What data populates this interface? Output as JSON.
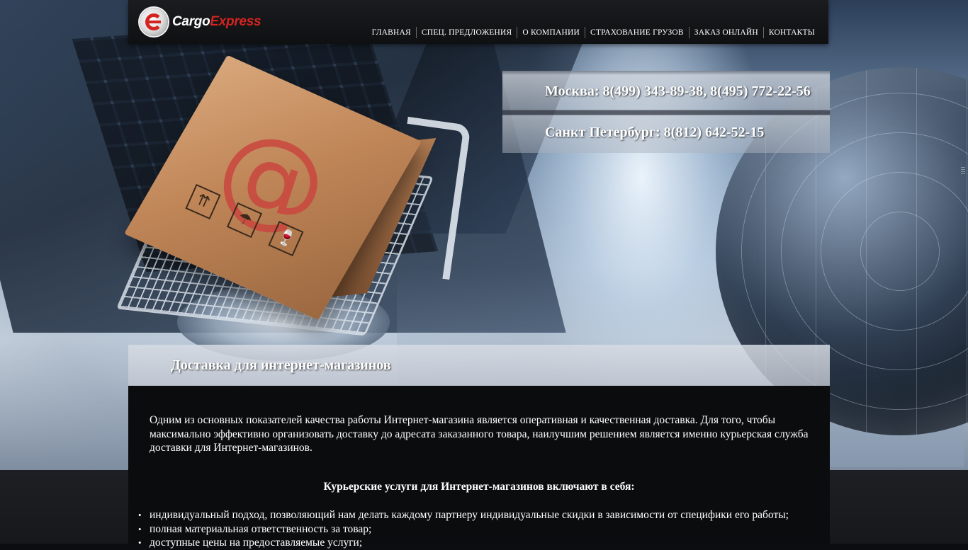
{
  "brand": {
    "logo_white": "Cargo",
    "logo_red": "Express"
  },
  "nav": {
    "items": [
      {
        "label": "ГЛАВНАЯ"
      },
      {
        "label": "СПЕЦ. ПРЕДЛОЖЕНИЯ"
      },
      {
        "label": "О КОМПАНИИ"
      },
      {
        "label": "СТРАХОВАНИЕ ГРУЗОВ"
      },
      {
        "label": "ЗАКАЗ ОНЛАЙН"
      },
      {
        "label": "КОНТАКТЫ"
      }
    ]
  },
  "phones": {
    "moscow": "Москва: 8(499) 343-89-38, 8(495) 772-22-56",
    "spb": "Санкт Петербург: 8(812) 642-52-15"
  },
  "page": {
    "title": "Доставка для интернет-магазинов",
    "intro": "Одним из основных показателей качества работы Интернет-магазина является оперативная и качественная доставка. Для того, чтобы максимально эффективно организовать доставку до адресата заказанного товара, наилучшим решением является именно курьерская служба доставки для Интернет-магазинов.",
    "subhead": "Курьерские услуги для Интернет-магазинов включают в себя:",
    "features": [
      "индивидуальный подход, позволяющий нам делать каждому партнеру индивидуальные скидки в зависимости от специфики его работы;",
      "полная материальная ответственность за товар;",
      "доступные цены на предоставляемые услуги;"
    ]
  },
  "colors": {
    "accent": "#d42420",
    "header_bg": "#141517",
    "content_bg": "#0b0c0e",
    "text": "#ffffff"
  },
  "icons": {
    "logo": "cargo-express-logo-icon",
    "box_symbols": [
      "this-side-up-icon",
      "keep-dry-icon",
      "fragile-icon"
    ]
  }
}
